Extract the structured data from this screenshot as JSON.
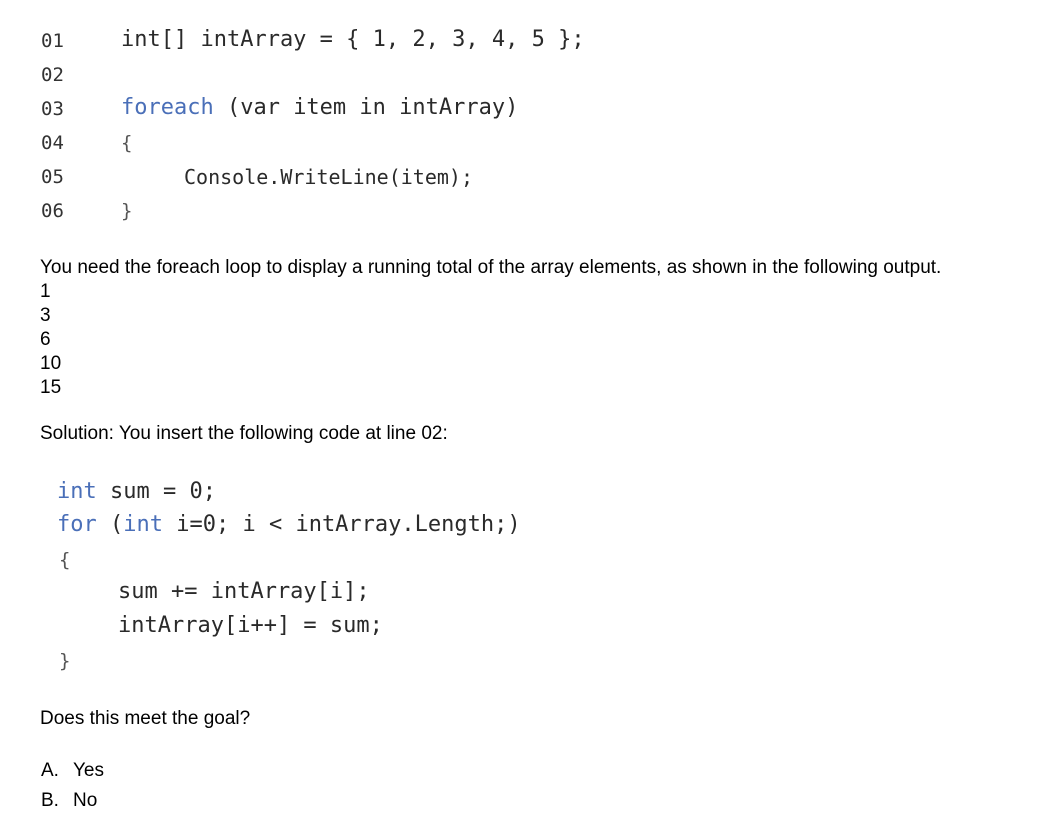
{
  "listing": {
    "lines": [
      {
        "num": "01",
        "code_kw": "",
        "code_rest": "int[] intArray = { 1, 2, 3, 4, 5 };"
      },
      {
        "num": "02",
        "code_kw": "",
        "code_rest": ""
      },
      {
        "num": "03",
        "code_kw": "foreach",
        "code_rest": " (var item in intArray)"
      },
      {
        "num": "04",
        "code_kw": "",
        "code_rest": "{"
      },
      {
        "num": "05",
        "code_kw": "",
        "code_rest": "Console.WriteLine(item);"
      },
      {
        "num": "06",
        "code_kw": "",
        "code_rest": "}"
      }
    ]
  },
  "question": {
    "statement": "You need the foreach loop to display a running total of the array elements, as shown in the following output.",
    "output": [
      "1",
      "3",
      "6",
      "10",
      "15"
    ],
    "solution_intro": "Solution: You insert the following code at line 02:"
  },
  "solution_code": {
    "line1_kw": "int",
    "line1_rest": " sum = 0;",
    "line2_kw1": "for",
    "line2_mid": " (",
    "line2_kw2": "int",
    "line2_rest": " i=0; i < intArray.Length;)",
    "open_brace": "{",
    "body1": "sum += intArray[i];",
    "body2": "intArray[i++] = sum;",
    "close_brace": "}"
  },
  "prompt": "Does this meet the goal?",
  "options": [
    {
      "letter": "A.",
      "text": "Yes"
    },
    {
      "letter": "B.",
      "text": "No"
    }
  ],
  "colors": {
    "keyword": "#4a6fb8",
    "text": "#000000"
  }
}
